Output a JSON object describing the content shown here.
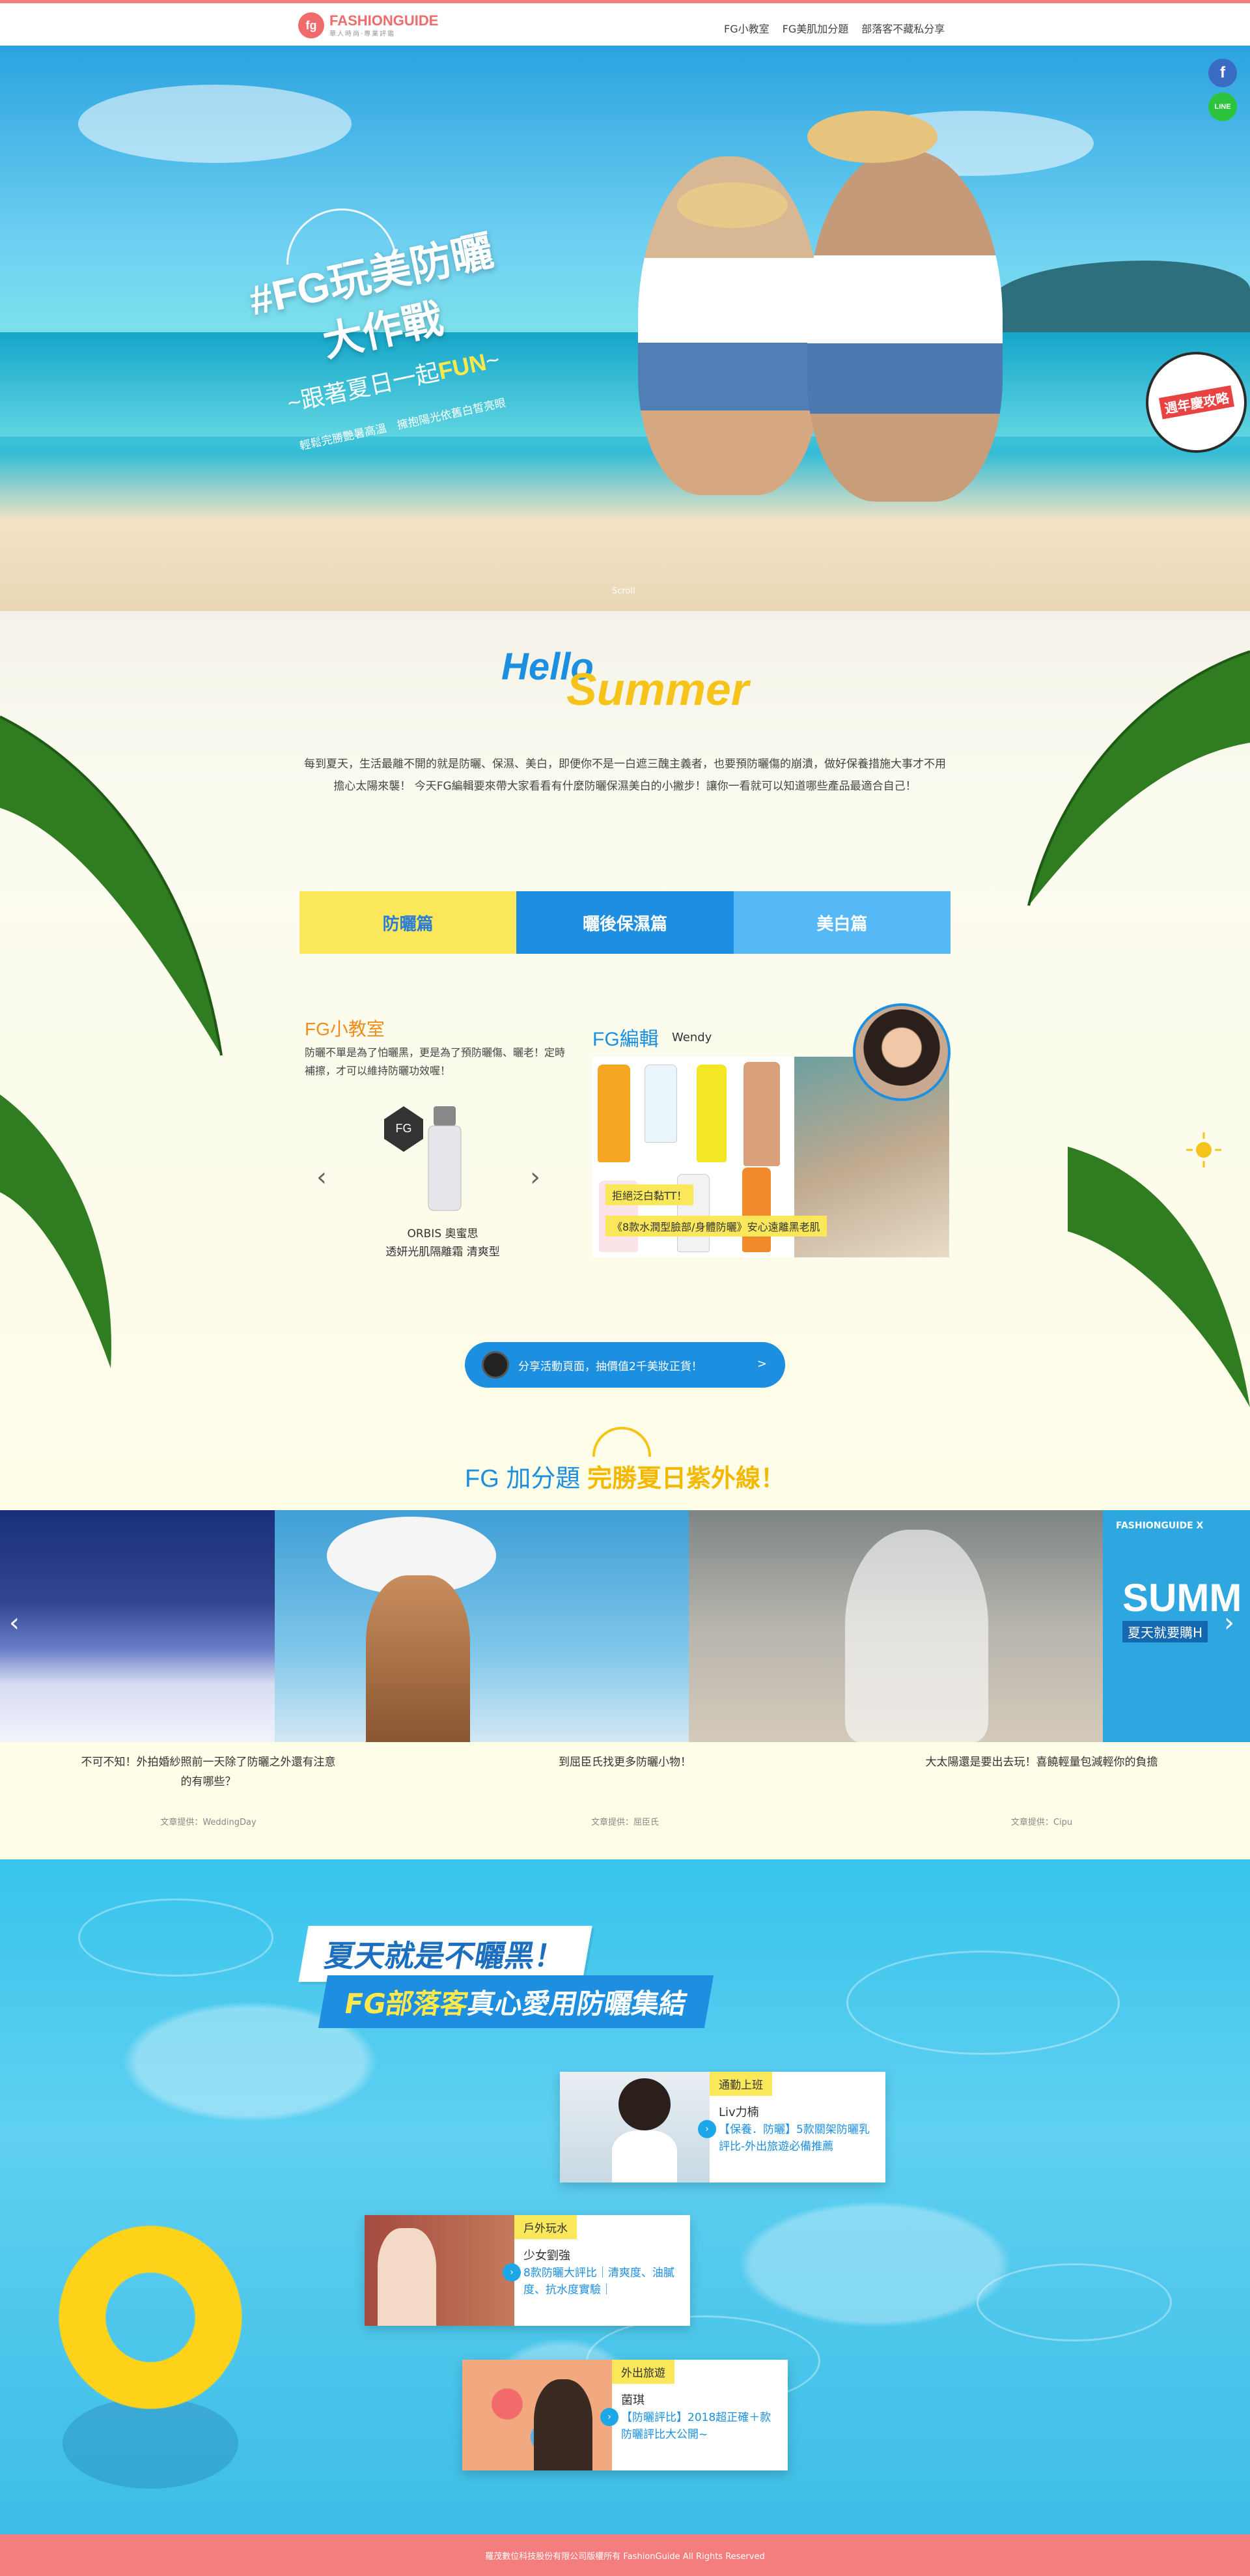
{
  "header": {
    "logo_text": "FASHIONGUIDE",
    "logo_sub": "華人時尚·專業評鑑",
    "logo_mark": "fg",
    "nav": [
      "FG小教室",
      "FG美肌加分題",
      "部落客不藏私分享"
    ]
  },
  "hero": {
    "title_line1": "#FG玩美防曬",
    "title_line2": "大作戰",
    "subtitle_prefix": "~跟著夏日一起",
    "subtitle_highlight": "FUN",
    "subtitle_suffix": "~",
    "tagline": "輕鬆完勝艷暑高溫　擁抱陽光依舊白皙亮眼",
    "scroll": "Scroll",
    "badge": "週年慶攻略",
    "social_fb": "f",
    "social_line": "LINE"
  },
  "summer": {
    "hello": "Hello",
    "summer": "Summer",
    "intro": "每到夏天，生活最離不開的就是防曬、保濕、美白，即便你不是一白遮三醜主義者，也要預防曬傷的崩潰，做好保養措施大事才不用擔心太陽來襲！ 今天FG編輯要來帶大家看看有什麼防曬保濕美白的小撇步！讓你一看就可以知道哪些產品最適合自己！",
    "tabs": [
      "防曬篇",
      "曬後保濕篇",
      "美白篇"
    ]
  },
  "fgclass": {
    "title": "FG小教室",
    "body": "防曬不單是為了怕曬黑，更是為了預防曬傷、曬老！定時補擦，才可以維持防曬功效喔！",
    "product_caption_line1": "ORBIS 奧蜜思",
    "product_caption_line2": "透妍光肌隔離霜 清爽型",
    "product_badge": "FG"
  },
  "editor": {
    "title": "FG編輯",
    "name": "Wendy",
    "label1": "拒絕泛白黏TT！",
    "label2": "《8款水潤型臉部/身體防曬》安心遠離黑老肌"
  },
  "share": {
    "label": "分享活動頁面，抽價值2千美妝正貨！",
    "arrow": ">"
  },
  "bonus": {
    "title_prefix": "FG 加分題 ",
    "title_highlight": "完勝夏日紫外線！"
  },
  "carousel": {
    "items": [
      {
        "caption_line1": "不可不知！外拍婚紗照前一天除了防曬之外還有注意",
        "caption_line2": "的有哪些？",
        "source": "文章提供：WeddingDay"
      },
      {
        "caption_line1": "到屈臣氏找更多防曬小物！",
        "caption_line2": "",
        "source": "文章提供：屈臣氏"
      },
      {
        "caption_line1": "大太陽還是要出去玩！喜饒輕量包減輕你的負擔",
        "caption_line2": "",
        "source": "文章提供：Cipu"
      }
    ],
    "side_text": "SUMM",
    "side_sub": "夏天就要購H",
    "side_brand": "FASHIONGUIDE X"
  },
  "bloggers": {
    "title1": "夏天就是不曬黑！",
    "title2_highlight": "FG部落客",
    "title2_rest": "真心愛用防曬集結",
    "cards": [
      {
        "tag": "通勤上班",
        "name": "Liv力楠",
        "desc": "【保養．防曬】5款關架防曬乳評比-外出旅遊必備推薦"
      },
      {
        "tag": "戶外玩水",
        "name": "少女劉強",
        "desc": "8款防曬大評比｜清爽度、油膩度、抗水度實驗｜"
      },
      {
        "tag": "外出旅遊",
        "name": "菌琪",
        "desc": "【防曬評比】2018超正確＋款防曬評比大公開~"
      }
    ]
  },
  "footer": {
    "text": "羅茂數位科技股份有限公司版權所有 FashionGuide All Rights Reserved"
  }
}
